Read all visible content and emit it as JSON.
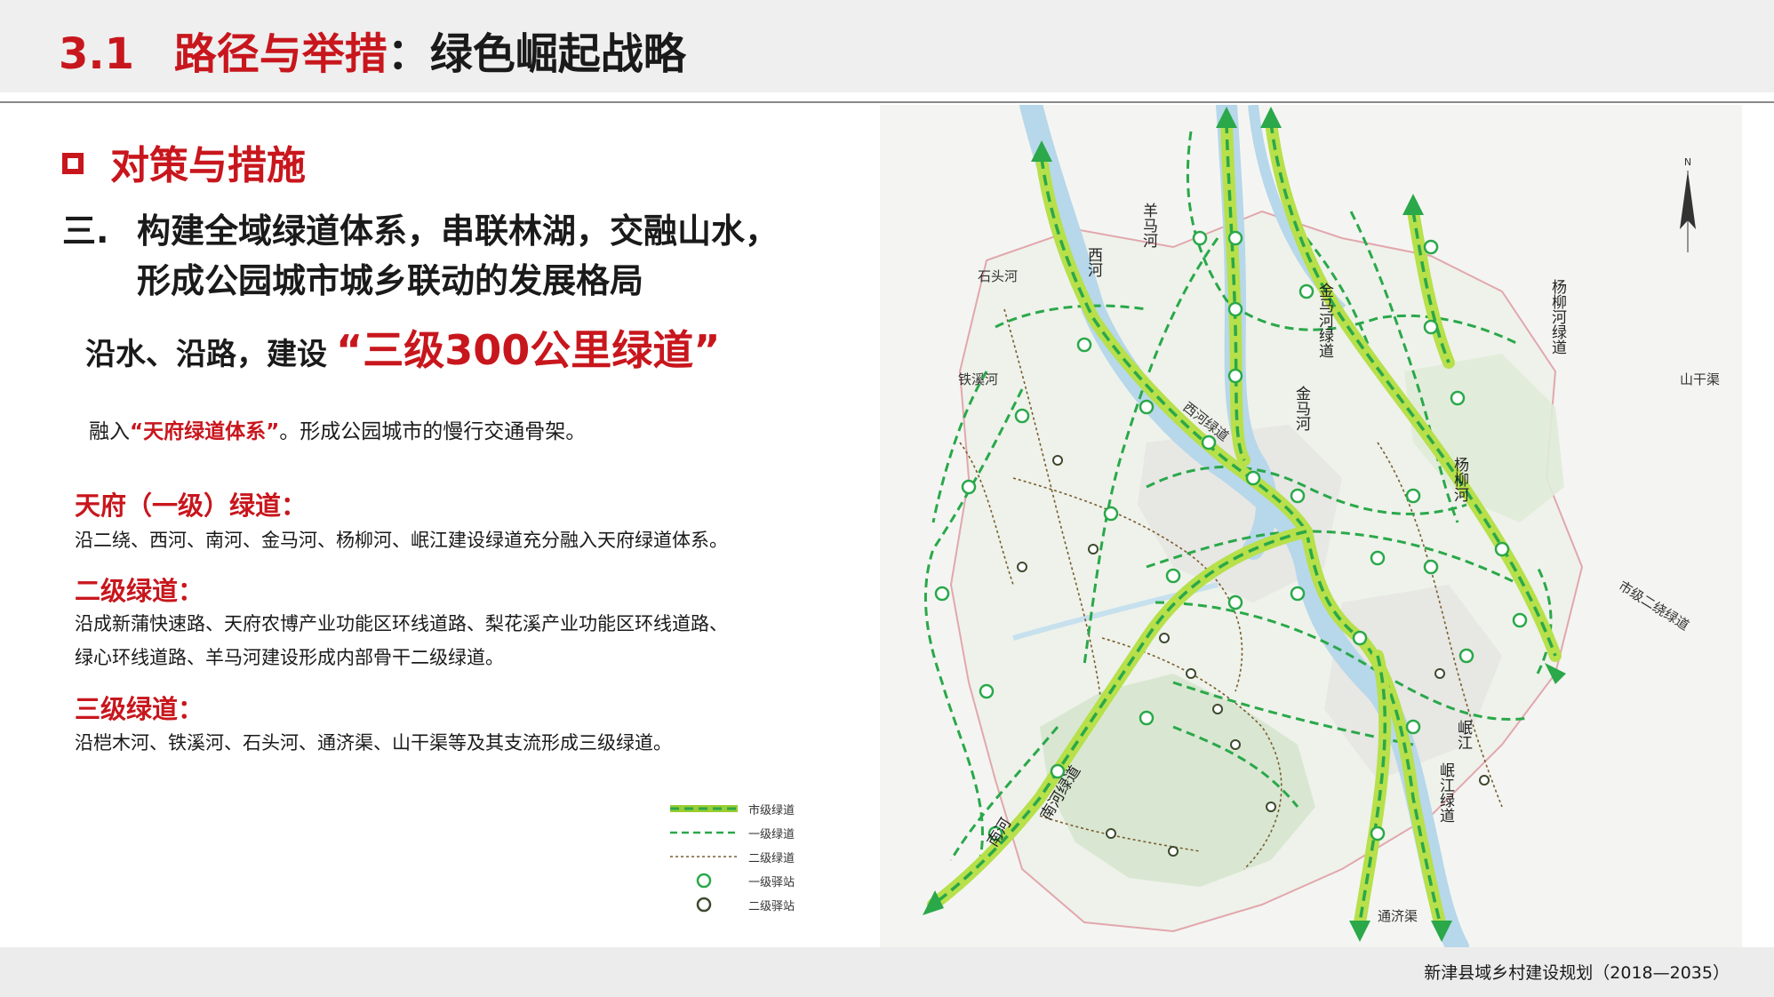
{
  "header": {
    "number": "3.1",
    "title_red": "路径与举措",
    "colon": "：",
    "title_dark": "绿色崛起战略"
  },
  "section": {
    "title": "对策与措施"
  },
  "point": {
    "number": "三.",
    "line1": "构建全域绿道体系，串联林湖，交融山水，",
    "line2": "形成公园城市城乡联动的发展格局"
  },
  "tagline": {
    "lead": "沿水、沿路，建设",
    "highlight": "“三级300公里绿道”"
  },
  "intro": {
    "prefix": "融入",
    "highlight": "“天府绿道体系”",
    "suffix": "。形成公园城市的慢行交通骨架。"
  },
  "levels": [
    {
      "title": "天府（一级）绿道：",
      "lines": [
        "沿二绕、西河、南河、金马河、杨柳河、岷江建设绿道充分融入天府绿道体系。"
      ]
    },
    {
      "title": "二级绿道：",
      "lines": [
        "沿成新蒲快速路、天府农博产业功能区环线道路、梨花溪产业功能区环线道路、",
        "绿心环线道路、羊马河建设形成内部骨干二级绿道。"
      ]
    },
    {
      "title": "三级绿道：",
      "lines": [
        "沿桤木河、铁溪河、石头河、通济渠、山干渠等及其支流形成三级绿道。"
      ]
    }
  ],
  "legend": [
    {
      "label": "市级绿道",
      "symbol": "thick-dash"
    },
    {
      "label": "一级绿道",
      "symbol": "green-dash"
    },
    {
      "label": "二级绿道",
      "symbol": "brown-dot"
    },
    {
      "label": "一级驿站",
      "symbol": "green-circle"
    },
    {
      "label": "二级驿站",
      "symbol": "dark-circle"
    }
  ],
  "map": {
    "labels": {
      "shitouhe": "石头河",
      "tiexihe": "铁溪河",
      "shanganqu": "山干渠",
      "tongjiqu": "通济渠",
      "yangmahe": "羊马河",
      "xihe": "西河",
      "xihe_greenway": "西河绿道",
      "jinmahe_greenway": "金马河绿道",
      "jinmahe": "金马河",
      "yangliuhe_greenway": "杨柳河绿道",
      "yangliuhe": "杨柳河",
      "ring_greenway": "市级二绕绿道",
      "minjiang": "岷江",
      "minjiang_greenway": "岷江绿道",
      "nanhe": "南河",
      "nanhe_greenway": "南河绿道",
      "north": "N"
    },
    "colors": {
      "city_greenway": "#9acd32",
      "level1": "#2aa84a",
      "level2": "#7a5c2e",
      "river": "#b7d7ea"
    }
  },
  "footer": {
    "text": "新津县域乡村建设规划（2018—2035）"
  }
}
